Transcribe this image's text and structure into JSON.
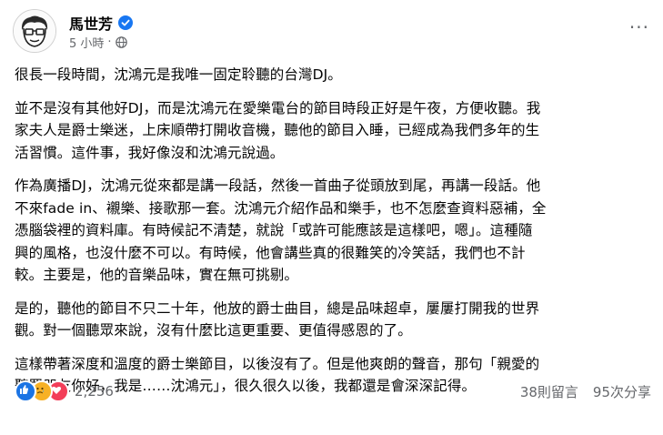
{
  "post": {
    "author": "馬世芳",
    "timestamp": "5 小時",
    "separator": "·",
    "privacy_icon": "globe-icon",
    "verified_icon": "verified-badge-icon",
    "more_label": "···"
  },
  "paragraphs": [
    [
      "很長一段時間，沈鴻元是我唯一固定聆聽的台灣DJ。"
    ],
    [
      "並不是沒有其他好DJ，而是沈鴻元在愛樂電台的節目時段正好是午夜，方便收聽。我",
      "家夫人是爵士樂迷，上床順帶打開收音機，聽他的節目入睡，已經成為我們多年的生",
      "活習慣。這件事，我好像沒和沈鴻元說過。"
    ],
    [
      "作為廣播DJ，沈鴻元從來都是講一段話，然後一首曲子從頭放到尾，再講一段話。他",
      "不來fade in、襯樂、接歌那一套。沈鴻元介紹作品和樂手，也不怎麼查資料惡補，全",
      "憑腦袋裡的資料庫。有時候記不清楚，就說「或許可能應該是這樣吧，嗯」。這種隨",
      "興的風格，也沒什麼不可以。有時候，他會講些真的很難笑的冷笑話，我們也不計",
      "較。主要是，他的音樂品味，實在無可挑剔。"
    ],
    [
      "是的，聽他的節目不只二十年，他放的爵士曲目，總是品味超卓，屢屢打開我的世界",
      "觀。對一個聽眾來說，沒有什麼比這更重要、更值得感恩的了。"
    ],
    [
      "這樣帶著深度和溫度的爵士樂節目，以後沒有了。但是他爽朗的聲音，那句「親愛的",
      "聽眾朋友你好，我是……沈鴻元」，很久很久以後，我都還是會深深記得。"
    ]
  ],
  "footer": {
    "reaction_icons": [
      "like-icon",
      "sad-icon",
      "love-icon"
    ],
    "reaction_count": "2,256",
    "comments": "38則留言",
    "shares": "95次分享"
  },
  "colors": {
    "text": "#050505",
    "secondary": "#65676b",
    "like": "#1b74e4",
    "verified": "#1877f2",
    "love": "#f33e58",
    "sad": "#f7b125"
  }
}
